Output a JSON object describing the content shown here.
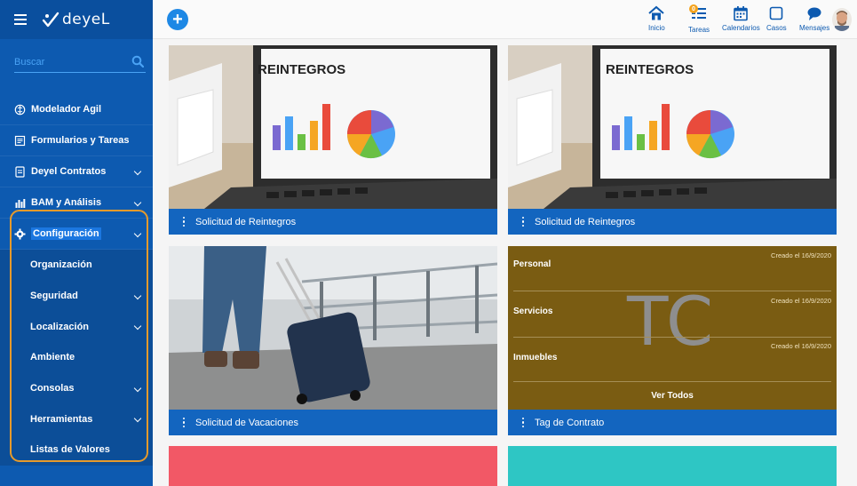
{
  "app": {
    "logo_text": "deyeL"
  },
  "sidebar": {
    "search_placeholder": "Buscar",
    "items": [
      {
        "label": "Modelador Agil",
        "icon": "brain-icon",
        "has_chevron": false
      },
      {
        "label": "Formularios y Tareas",
        "icon": "form-icon",
        "has_chevron": false
      },
      {
        "label": "Deyel Contratos",
        "icon": "document-icon",
        "has_chevron": true
      },
      {
        "label": "BAM y Análisis",
        "icon": "chart-icon",
        "has_chevron": true
      },
      {
        "label": "Configuración",
        "icon": "gear-icon",
        "has_chevron": true,
        "expanded": true
      }
    ],
    "config_subitems": [
      {
        "label": "Organización",
        "has_chevron": false
      },
      {
        "label": "Seguridad",
        "has_chevron": true
      },
      {
        "label": "Localización",
        "has_chevron": true
      },
      {
        "label": "Ambiente",
        "has_chevron": false
      },
      {
        "label": "Consolas",
        "has_chevron": true
      },
      {
        "label": "Herramientas",
        "has_chevron": true
      },
      {
        "label": "Listas de Valores",
        "has_chevron": false
      }
    ]
  },
  "topbar": {
    "buttons": [
      {
        "label": "Inicio",
        "icon": "home-icon"
      },
      {
        "label": "Tareas",
        "icon": "tasks-icon",
        "badge": "0"
      },
      {
        "label": "Calendarios",
        "icon": "calendar-icon"
      },
      {
        "label": "Casos",
        "icon": "case-icon"
      },
      {
        "label": "Mensajes",
        "icon": "message-icon"
      }
    ]
  },
  "cards": [
    {
      "title": "Solicitud de Reintegros",
      "image_text": "REINTEGROS"
    },
    {
      "title": "Solicitud de Reintegros",
      "image_text": "REINTEGROS"
    },
    {
      "title": "Solicitud de Vacaciones"
    },
    {
      "title": "Tag de Contrato"
    }
  ],
  "tag_panel": {
    "watermark": "TC",
    "rows": [
      {
        "label": "Personal",
        "date": "Creado el 16/9/2020"
      },
      {
        "label": "Servicios",
        "date": "Creado el 16/9/2020"
      },
      {
        "label": "Inmuebles",
        "date": "Creado el 16/9/2020"
      }
    ],
    "view_all": "Ver Todos"
  },
  "colors": {
    "sidebar_bg": "#0d5ab0",
    "accent": "#1e88e5",
    "card_footer": "#1365bf",
    "tag_bg": "#7a5c12",
    "highlight_border": "#e69a2b",
    "bottom_card_left": "#f25866",
    "bottom_card_right": "#2ec6c4"
  }
}
